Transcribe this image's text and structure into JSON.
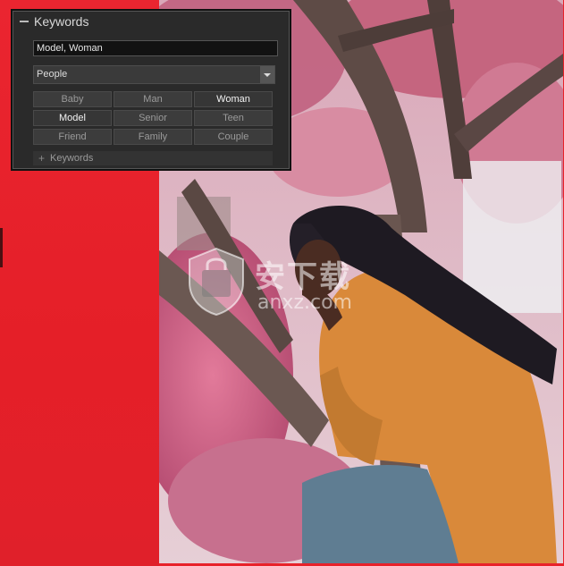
{
  "panel": {
    "title": "Keywords",
    "keywords_value": "Model, Woman",
    "category_selected": "People",
    "buttons": [
      {
        "label": "Baby",
        "active": false
      },
      {
        "label": "Man",
        "active": false
      },
      {
        "label": "Woman",
        "active": true
      },
      {
        "label": "Model",
        "active": true
      },
      {
        "label": "Senior",
        "active": false
      },
      {
        "label": "Teen",
        "active": false
      },
      {
        "label": "Friend",
        "active": false
      },
      {
        "label": "Family",
        "active": false
      },
      {
        "label": "Couple",
        "active": false
      }
    ],
    "sub_section_label": "Keywords"
  },
  "watermark": {
    "text": "安下载",
    "sub": "anxz.com"
  },
  "colors": {
    "background_red": "#e8222a",
    "panel_bg": "#2a2a2a"
  },
  "icons": {
    "collapse": "minus-icon",
    "dropdown": "chevron-down-icon",
    "expand": "plus-icon"
  }
}
